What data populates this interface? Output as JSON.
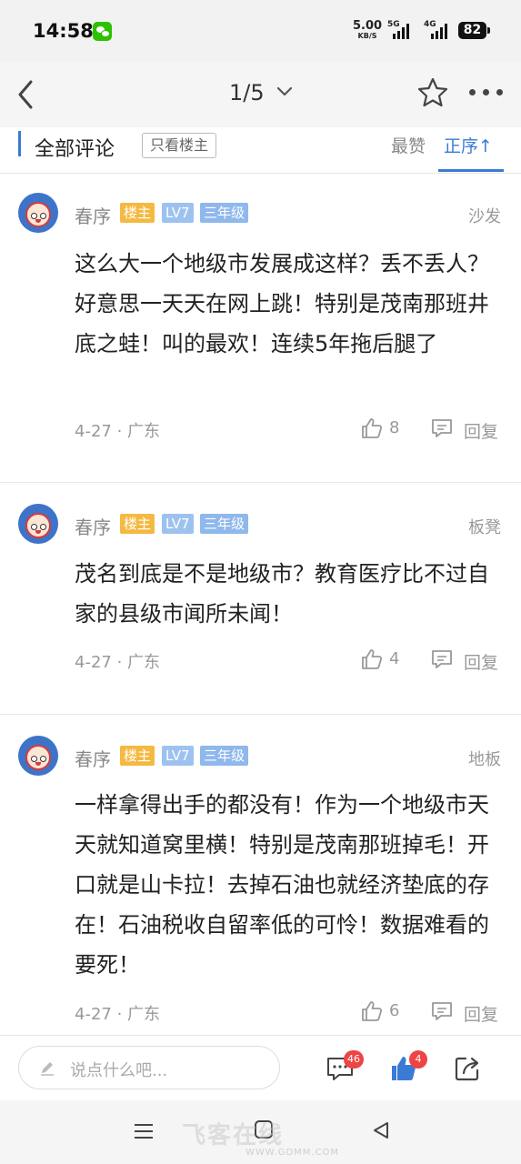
{
  "status_bar": {
    "time": "14:58",
    "speed_value": "5.00",
    "speed_unit": "KB/S",
    "net1": "5G",
    "net2": "4G",
    "battery": "82",
    "icons": [
      "wechat-icon",
      "signal-icon",
      "battery-icon"
    ]
  },
  "nav": {
    "page_indicator": "1/5",
    "icons": [
      "back-arrow-icon",
      "chevron-down-icon",
      "star-icon",
      "more-icon"
    ]
  },
  "filter": {
    "title": "全部评论",
    "only_host": "只看楼主",
    "sort_hot": "最赞",
    "sort_asc": "正序↑",
    "accent_color": "#3a7bd5"
  },
  "comments": [
    {
      "username": "春序",
      "badge_host": "楼主",
      "badge_level": "LV7",
      "badge_grade": "三年级",
      "floor": "沙发",
      "text": "这么大一个地级市发展成这样？丢不丢人？好意思一天天在网上跳！特别是茂南那班井底之蛙！叫的最欢！连续5年拖后腿了",
      "date_loc": "4-27 · 广东",
      "likes": "8",
      "reply_label": "回复"
    },
    {
      "username": "春序",
      "badge_host": "楼主",
      "badge_level": "LV7",
      "badge_grade": "三年级",
      "floor": "板凳",
      "text": "茂名到底是不是地级市？教育医疗比不过自家的县级市闻所未闻！",
      "date_loc": "4-27 · 广东",
      "likes": "4",
      "reply_label": "回复"
    },
    {
      "username": "春序",
      "badge_host": "楼主",
      "badge_level": "LV7",
      "badge_grade": "三年级",
      "floor": "地板",
      "text": "一样拿得出手的都没有！作为一个地级市天天就知道窝里横！特别是茂南那班掉毛！开口就是山卡拉！去掉石油也就经济垫底的存在！石油税收自留率低的可怜！数据难看的要死！",
      "date_loc": "4-27 · 广东",
      "likes": "6",
      "reply_label": "回复"
    }
  ],
  "bottom_bar": {
    "input_placeholder": "说点什么吧...",
    "comments_count": "46",
    "likes_count": "4",
    "icons": [
      "pencil-icon",
      "comment-icon",
      "thumbs-up-icon",
      "share-icon"
    ]
  },
  "watermark": {
    "text": "飞客在线",
    "url": "WWW.GDMM.COM"
  }
}
